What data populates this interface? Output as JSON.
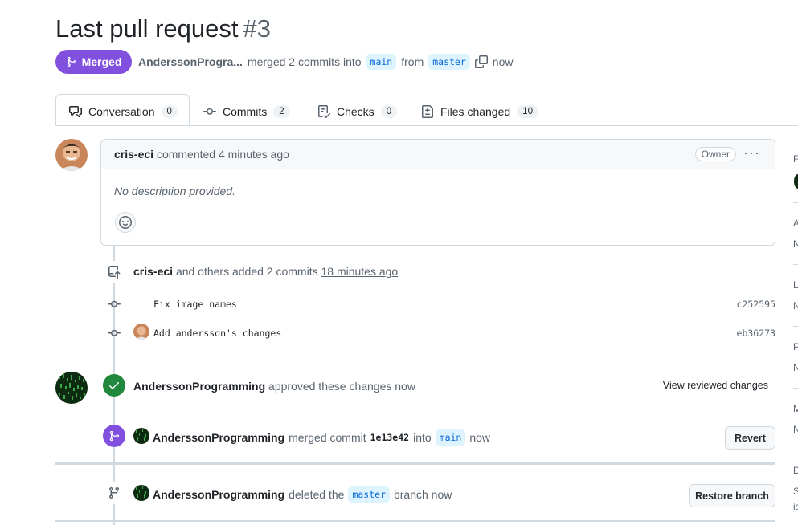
{
  "pr": {
    "title": "Last pull request",
    "number": "#3",
    "state": "Merged",
    "author": "AnderssonProgra...",
    "merged_text": "merged 2 commits into",
    "base_branch": "main",
    "from_text": "from",
    "head_branch": "master",
    "time": "now"
  },
  "tabs": [
    {
      "label": "Conversation",
      "count": "0",
      "icon": "comment-discussion-icon"
    },
    {
      "label": "Commits",
      "count": "2",
      "icon": "git-commit-icon"
    },
    {
      "label": "Checks",
      "count": "0",
      "icon": "checklist-icon"
    },
    {
      "label": "Files changed",
      "count": "10",
      "icon": "file-diff-icon"
    }
  ],
  "comment": {
    "author": "cris-eci",
    "action": "commented 4 minutes ago",
    "badge": "Owner",
    "body": "No description provided."
  },
  "commits_event": {
    "author": "cris-eci",
    "text": "and others added 2 commits",
    "time": "18 minutes ago",
    "commits": [
      {
        "message": "Fix image names",
        "sha": "c252595"
      },
      {
        "message": "Add andersson's changes",
        "sha": "eb36273"
      }
    ]
  },
  "review_event": {
    "author": "AnderssonProgramming",
    "text": "approved these changes now",
    "action": "View reviewed changes"
  },
  "merge_event": {
    "author": "AnderssonProgramming",
    "text": "merged commit",
    "sha": "1e13e42",
    "into": "into",
    "branch": "main",
    "time": "now",
    "button": "Revert"
  },
  "delete_event": {
    "author": "AnderssonProgramming",
    "text": "deleted the",
    "branch": "master",
    "suffix": "branch now",
    "button": "Restore branch"
  },
  "sidebar_initials": [
    "F",
    "A",
    "N",
    "L",
    "N",
    "P",
    "N",
    "M",
    "N",
    "D",
    "S",
    "is"
  ],
  "colors": {
    "merged": "#8250df",
    "approved": "#1f883d",
    "branch_bg": "#ddf4ff",
    "branch_fg": "#0969da"
  }
}
